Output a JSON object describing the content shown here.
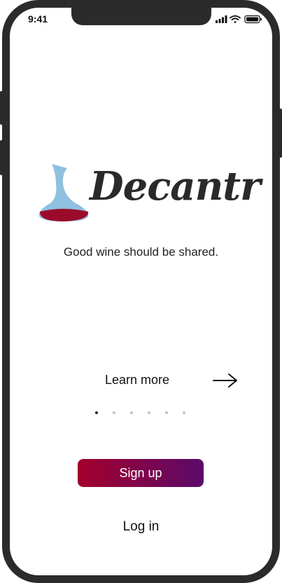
{
  "status_bar": {
    "time": "9:41"
  },
  "brand": {
    "name": "Decantr"
  },
  "tagline": "Good wine should be shared.",
  "learn_more": {
    "label": "Learn more"
  },
  "pager": {
    "count": 6,
    "active_index": 0
  },
  "actions": {
    "signup_label": "Sign up",
    "login_label": "Log in"
  },
  "colors": {
    "gradient_start": "#a3002c",
    "gradient_end": "#5b0a6a",
    "decanter_glass": "#8fc0e0",
    "wine": "#9c0a2b"
  },
  "icons": [
    "signal-icon",
    "wifi-icon",
    "battery-icon",
    "decanter-icon",
    "arrow-right-icon"
  ]
}
